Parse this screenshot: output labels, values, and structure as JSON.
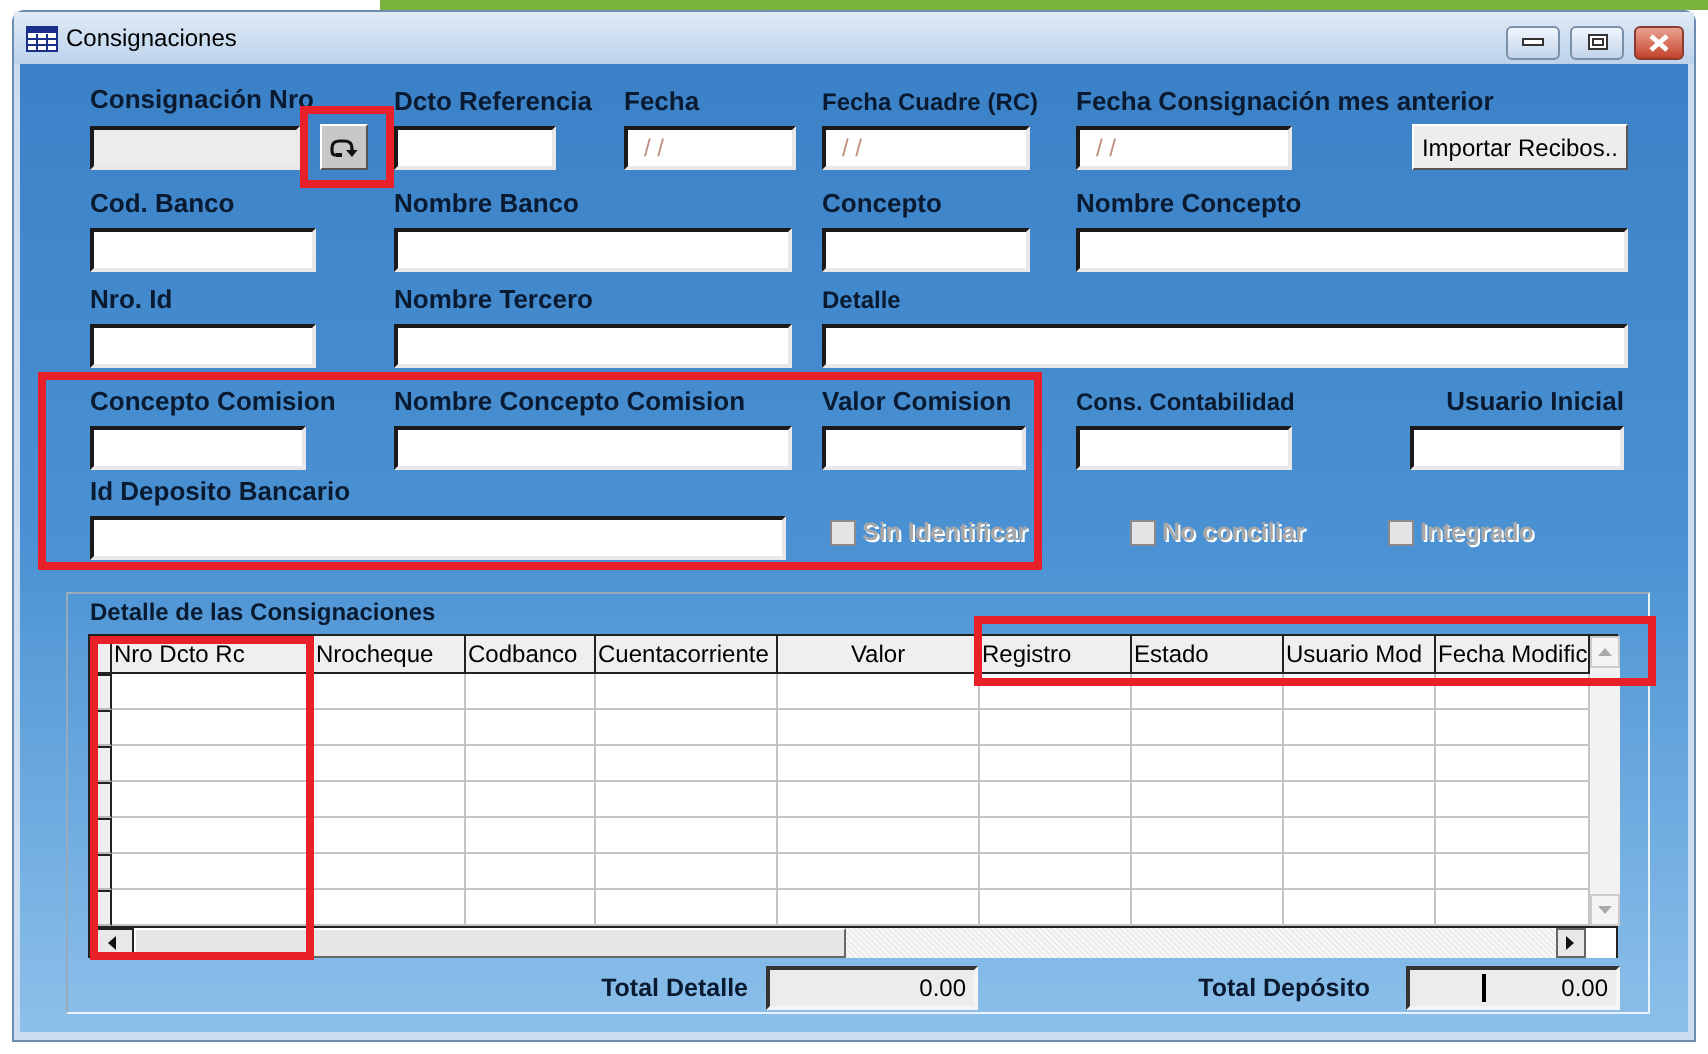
{
  "window": {
    "title": "Consignaciones"
  },
  "fields": {
    "consignacion_nro": {
      "label": "Consignación Nro",
      "disabled": true
    },
    "dcto_referencia": {
      "label": "Dcto Referencia"
    },
    "fecha": {
      "label": "Fecha",
      "value": "/ /"
    },
    "fecha_cuadre": {
      "label": "Fecha Cuadre (RC)",
      "value": "/ /"
    },
    "fecha_mes_anterior": {
      "label": "Fecha Consignación mes anterior",
      "value": "/ /"
    },
    "cod_banco": {
      "label": "Cod. Banco"
    },
    "nombre_banco": {
      "label": "Nombre Banco"
    },
    "concepto": {
      "label": "Concepto"
    },
    "nombre_concepto": {
      "label": "Nombre Concepto"
    },
    "nro_id": {
      "label": "Nro. Id"
    },
    "nombre_tercero": {
      "label": "Nombre Tercero"
    },
    "detalle": {
      "label": "Detalle"
    },
    "concepto_comision": {
      "label": "Concepto Comision"
    },
    "nombre_concepto_comision": {
      "label": "Nombre Concepto Comision"
    },
    "valor_comision": {
      "label": "Valor Comision"
    },
    "cons_contabilidad": {
      "label": "Cons. Contabilidad"
    },
    "usuario_inicial": {
      "label": "Usuario Inicial"
    },
    "id_deposito": {
      "label": "Id Deposito Bancario"
    }
  },
  "import_button": "Importar Recibos..",
  "checkboxes": [
    {
      "label": "Sin Identificar",
      "checked": false,
      "disabled": true
    },
    {
      "label": "No conciliar",
      "checked": false,
      "disabled": true
    },
    {
      "label": "Integrado",
      "checked": false,
      "disabled": true
    }
  ],
  "detail": {
    "title": "Detalle de las Consignaciones",
    "columns": [
      "Nro Dcto Rc",
      "Nrocheque",
      "Codbanco",
      "Cuentacorriente",
      "Valor",
      "Registro",
      "Estado",
      "Usuario Mod",
      "Fecha Modific"
    ]
  },
  "totals": [
    {
      "label": "Total Detalle",
      "value": "0.00"
    },
    {
      "label": "Total Depósito",
      "value": "0.00"
    }
  ],
  "highlights": {
    "refresh_button": true,
    "commission_section": true,
    "first_column": true,
    "header_tail": true
  }
}
